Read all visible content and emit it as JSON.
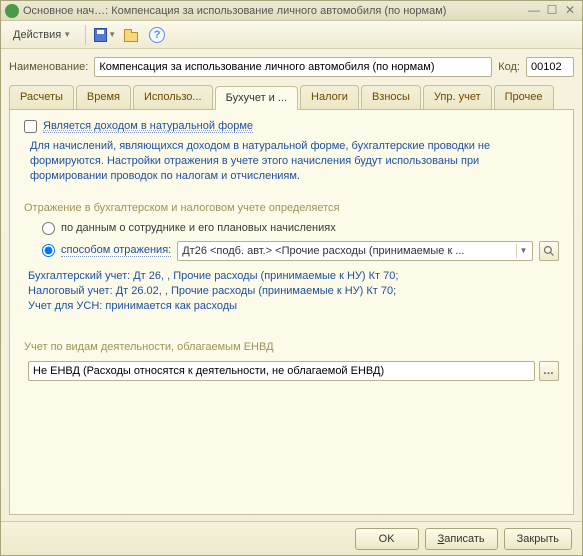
{
  "titlebar": {
    "text": "Основное нач…: Компенсация за использование личного автомобиля (по нормам)"
  },
  "toolbar": {
    "actions_label": "Действия"
  },
  "header": {
    "name_label": "Наименование:",
    "name_value": "Компенсация за использование личного автомобиля (по нормам)",
    "code_label": "Код:",
    "code_value": "00102"
  },
  "tabs": [
    {
      "label": "Расчеты"
    },
    {
      "label": "Время"
    },
    {
      "label": "Использо..."
    },
    {
      "label": "Бухучет и ..."
    },
    {
      "label": "Налоги"
    },
    {
      "label": "Взносы"
    },
    {
      "label": "Упр. учет"
    },
    {
      "label": "Прочее"
    }
  ],
  "active_tab_index": 3,
  "page": {
    "natural_income_label": "Является доходом в натуральной форме",
    "natural_income_checked": false,
    "help_text": "Для начислений, являющихся доходом в натуральной форме, бухгалтерские проводки не формируются. Настройки отражения в учете этого начисления будут использованы при формировании проводок по налогам и отчислениям.",
    "section_reflect": "Отражение в бухгалтерском и налоговом учете определяется",
    "radio_employee": {
      "label": "по данным о сотруднике и его плановых начислениях",
      "checked": false
    },
    "radio_method": {
      "label": "способом отражения:",
      "checked": true
    },
    "method_value": "Дт26 <подб. авт.> <Прочие расходы (принимаемые к ...",
    "accounting_lines": [
      {
        "label": "Бухгалтерский учет:",
        "value": "Дт 26, , Прочие расходы (принимаемые к НУ) Кт 70;"
      },
      {
        "label": "Налоговый учет:",
        "value": "Дт 26.02, , Прочие расходы (принимаемые к НУ) Кт 70;"
      },
      {
        "label": "Учет для УСН:",
        "value": "принимается как расходы"
      }
    ],
    "section_envd": "Учет по видам деятельности, облагаемым ЕНВД",
    "envd_value": "Не ЕНВД (Расходы относятся к деятельности, не облагаемой ЕНВД)"
  },
  "footer": {
    "ok": "OK",
    "save": "Записать",
    "close": "Закрыть"
  }
}
